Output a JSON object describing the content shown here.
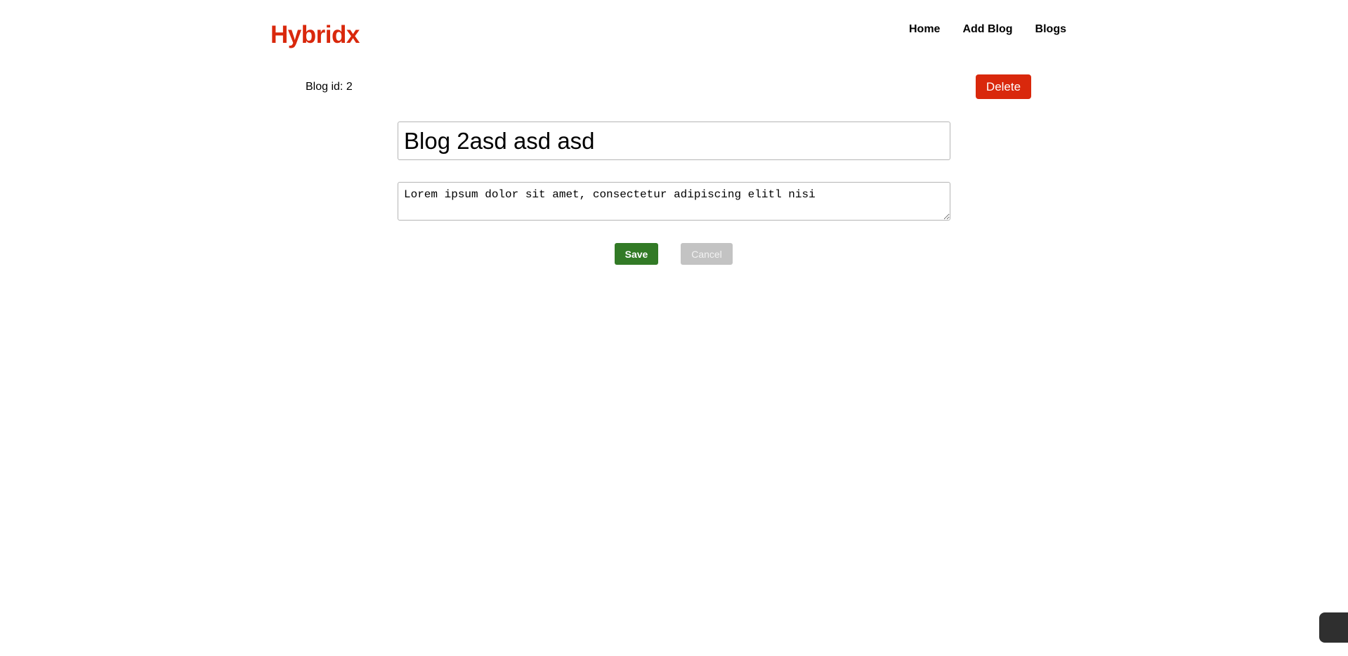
{
  "header": {
    "logo": "Hybridx",
    "nav": [
      {
        "label": "Home"
      },
      {
        "label": "Add Blog"
      },
      {
        "label": "Blogs"
      }
    ]
  },
  "editor": {
    "blog_id_label": "Blog id: 2",
    "delete_label": "Delete",
    "title_value": "Blog 2asd asd asd",
    "body_value": "Lorem ipsum dolor sit amet, consectetur adipiscing elitl nisi",
    "save_label": "Save",
    "cancel_label": "Cancel"
  },
  "colors": {
    "brand": "#d9280c",
    "save": "#327a26",
    "cancel": "#c3c3c3"
  }
}
